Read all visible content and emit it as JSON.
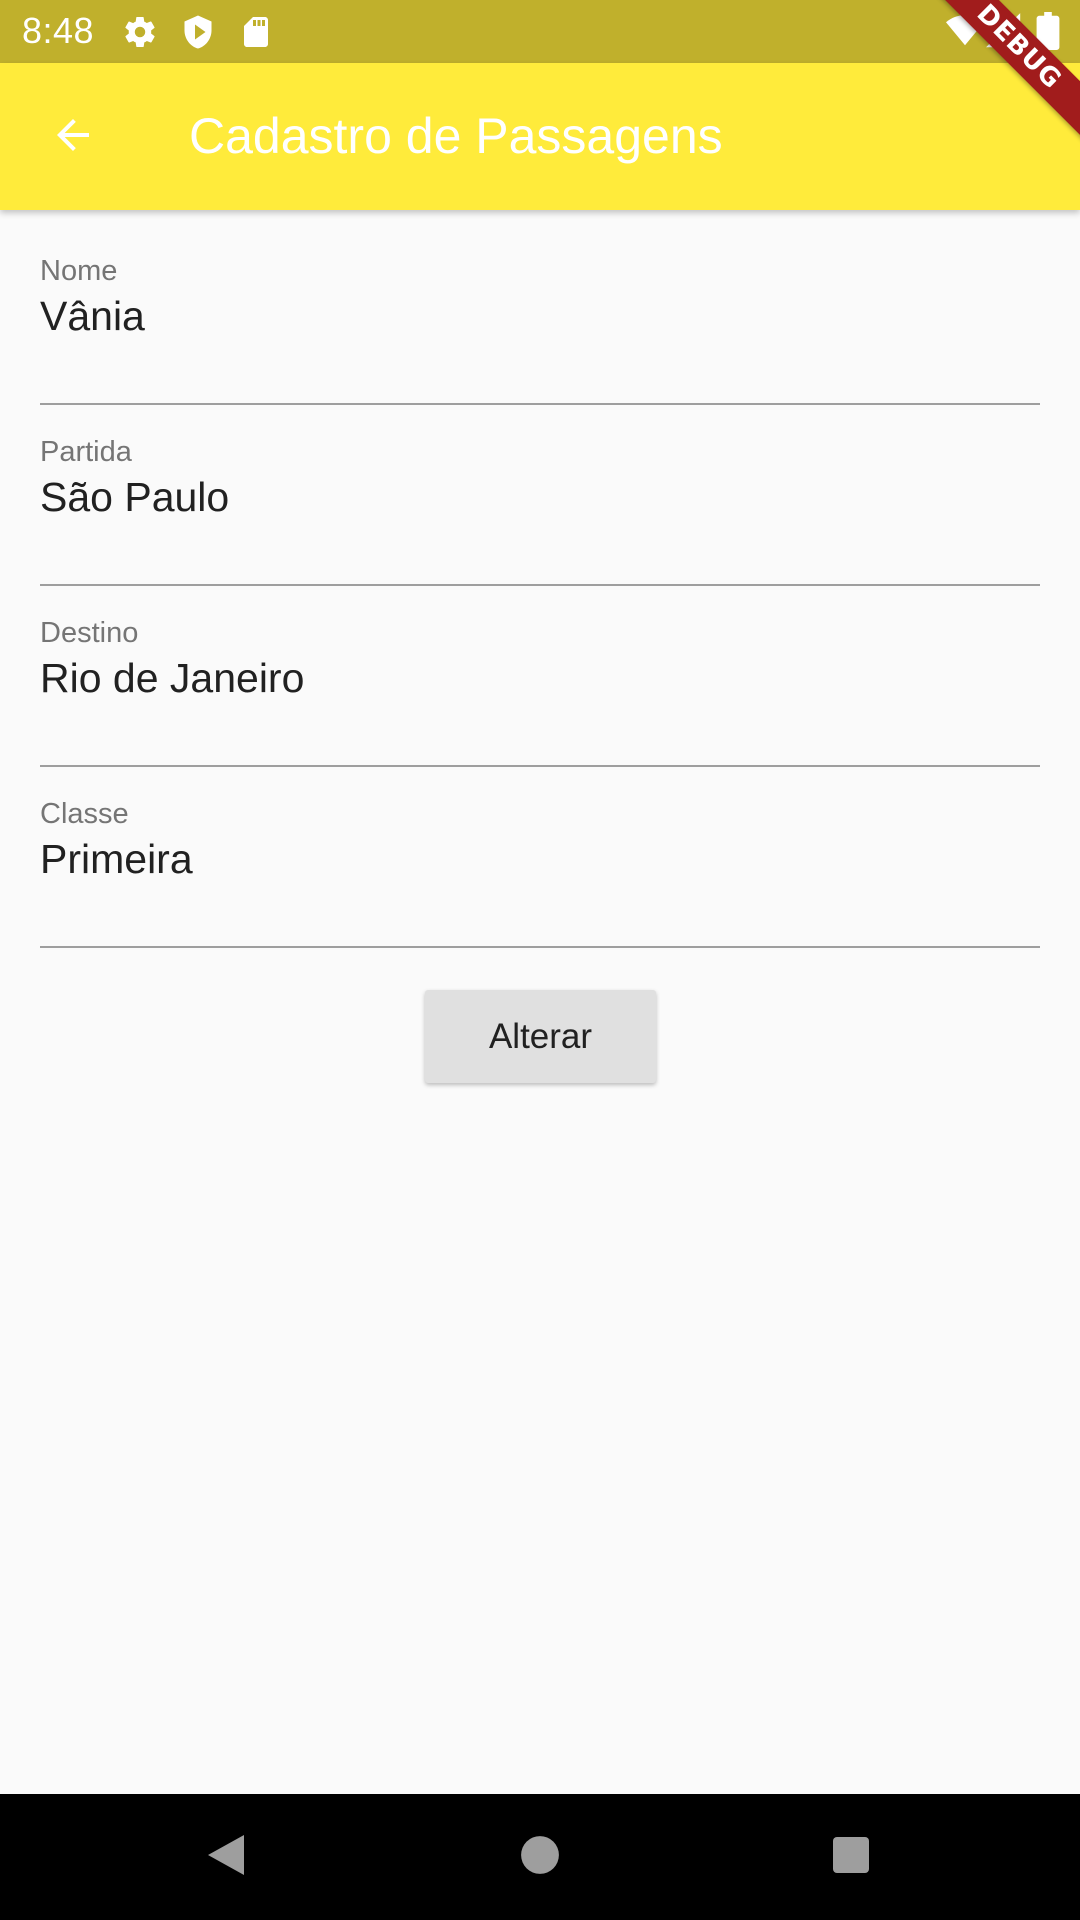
{
  "status_bar": {
    "time": "8:48",
    "icons": [
      "settings-icon",
      "shield-icon",
      "sd-card-icon",
      "wifi-icon",
      "signal-icon",
      "battery-icon"
    ]
  },
  "app_bar": {
    "title": "Cadastro de Passagens",
    "back_icon": "arrow-back-icon",
    "background_color": "#ffeb3b",
    "title_color": "#ffffff"
  },
  "debug_banner": {
    "label": "DEBUG"
  },
  "form": {
    "fields": [
      {
        "label": "Nome",
        "value": "Vânia"
      },
      {
        "label": "Partida",
        "value": "São Paulo"
      },
      {
        "label": "Destino",
        "value": "Rio de Janeiro"
      },
      {
        "label": "Classe",
        "value": "Primeira"
      }
    ],
    "submit_label": "Alterar"
  },
  "nav_bar": {
    "buttons": [
      "back-triangle-icon",
      "home-circle-icon",
      "recents-square-icon"
    ]
  }
}
